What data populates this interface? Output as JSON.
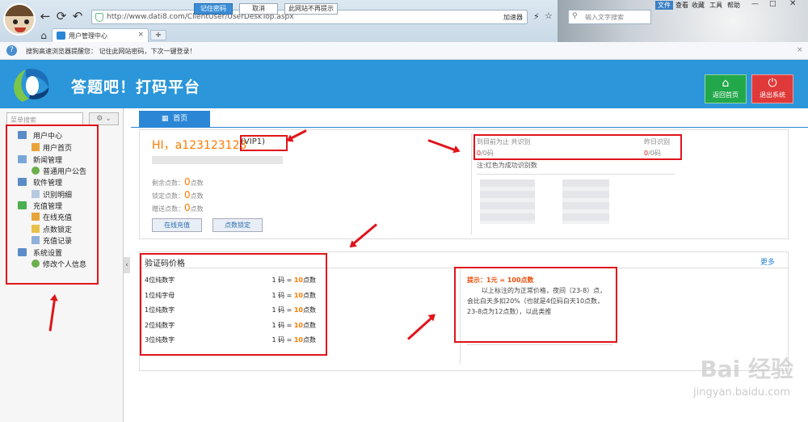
{
  "browser": {
    "url": "http://www.dati8.com/ClientUser/UserDeskTop.aspx",
    "accelerator_label": "加速器",
    "search_placeholder": "输入文字搜索",
    "menu": [
      "文件",
      "查看",
      "收藏",
      "工具",
      "帮助"
    ],
    "tab_title": "用户管理中心",
    "new_tab": "+",
    "tab_close": "×"
  },
  "notice": {
    "text": "搜狗高速浏览器提醒您： 记住此网站密码，下次一键登录！",
    "remember_label": "记住密码",
    "cancel_label": "取消",
    "never_label": "此网站不再提示",
    "close": "×"
  },
  "header": {
    "title": "答题吧！打码平台",
    "home_label": "返回首页",
    "logout_label": "退出系统",
    "brand_color": "#2b96d9",
    "logout_color": "#e0393a",
    "home_color": "#22a84a"
  },
  "sidebar": {
    "search_placeholder": "菜单搜索",
    "groups": [
      {
        "label": "用户中心",
        "items": [
          "用户首页"
        ]
      },
      {
        "label": "新闻管理",
        "items": [
          "普通用户公告"
        ]
      },
      {
        "label": "软件管理",
        "items": [
          "识别明细"
        ]
      },
      {
        "label": "充值管理",
        "items": [
          "在线充值",
          "点数锁定",
          "充值记录"
        ]
      },
      {
        "label": "系统设置",
        "items": [
          "修改个人信息"
        ]
      }
    ]
  },
  "main": {
    "home_tab": "首页",
    "greeting": "HI，a123123123",
    "vip": "(VIP1)",
    "stats": [
      {
        "label": "剩余点数：",
        "value": "0",
        "unit": "点数"
      },
      {
        "label": "锁定点数：",
        "value": "0",
        "unit": "点数"
      },
      {
        "label": "赠送点数：",
        "value": "0",
        "unit": "点数"
      }
    ],
    "recharge_label": "在线充值",
    "lock_label": "点数锁定",
    "recognition": {
      "total_label": "到目前为止 共识别",
      "yesterday_label": "昨日识别",
      "total_value": "0",
      "total_unit": "/0码",
      "yesterday_value": "0",
      "yesterday_unit": "/0码",
      "note": "注:红色为成功识别数"
    }
  },
  "price": {
    "title": "验证码价格",
    "more": "更多",
    "rows": [
      {
        "name": "4位纯数字",
        "left": "1 码 = ",
        "points": "10",
        "unit": "点数"
      },
      {
        "name": "1位纯字母",
        "left": "1 码 = ",
        "points": "10",
        "unit": "点数"
      },
      {
        "name": "1位纯数字",
        "left": "1 码 = ",
        "points": "10",
        "unit": "点数"
      },
      {
        "name": "2位纯数字",
        "left": "1 码 = ",
        "points": "10",
        "unit": "点数"
      },
      {
        "name": "3位纯数字",
        "left": "1 码 = ",
        "points": "10",
        "unit": "点数"
      }
    ],
    "tip_title": "提示：1元 = 100点数",
    "tip_body": "以上标注的为正常价格，夜间（23-8）点，会比白天多扣20%（也就是4位码白天10点数，23-8点为12点数），以此类推"
  },
  "watermark": {
    "brand": "Bai 经验",
    "url": "jingyan.baidu.com"
  }
}
